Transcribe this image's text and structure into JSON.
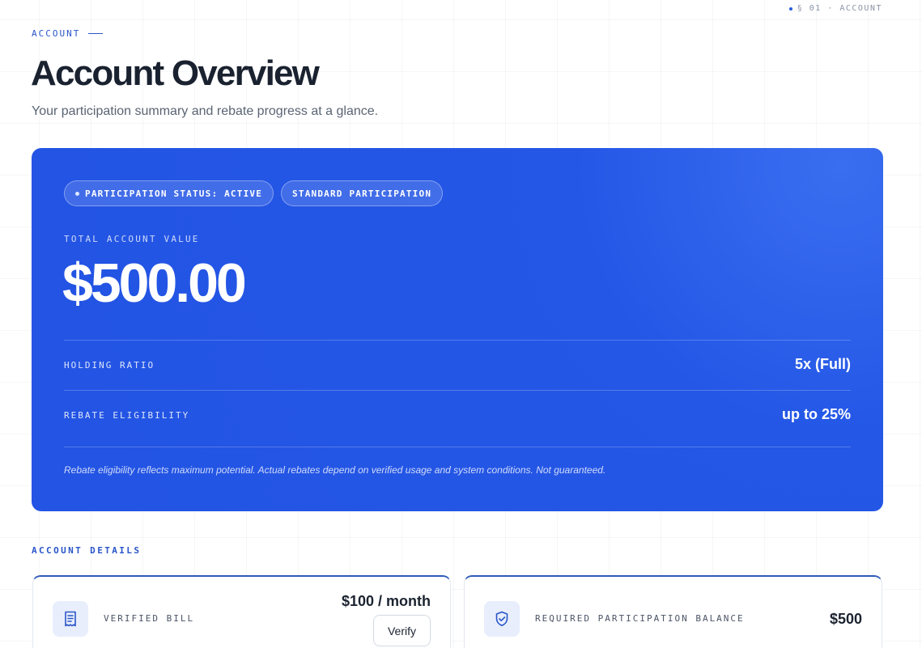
{
  "top_tag": "§ 01 · ACCOUNT",
  "header": {
    "eyebrow": "ACCOUNT",
    "title": "Account Overview",
    "subtitle": "Your participation summary and rebate progress at a glance."
  },
  "hero": {
    "badges": [
      "PARTICIPATION STATUS: ACTIVE",
      "STANDARD PARTICIPATION"
    ],
    "value_label": "TOTAL ACCOUNT VALUE",
    "value": "$500.00",
    "rows": [
      {
        "label": "HOLDING RATIO",
        "value": "5x (Full)"
      },
      {
        "label": "REBATE ELIGIBILITY",
        "value": "up to 25%"
      }
    ],
    "disclaimer": "Rebate eligibility reflects maximum potential. Actual rebates depend on verified usage and system conditions. Not guaranteed."
  },
  "details": {
    "section_label": "ACCOUNT DETAILS",
    "cards": [
      {
        "icon": "receipt-icon",
        "label": "VERIFIED BILL",
        "value": "$100 / month",
        "button": "Verify"
      },
      {
        "icon": "shield-check-icon",
        "label": "REQUIRED PARTICIPATION BALANCE",
        "value": "$500"
      }
    ]
  },
  "colors": {
    "accent": "#2a55c9",
    "hero_bg": "#2354e4",
    "card_border_top": "#2d5bb8"
  }
}
